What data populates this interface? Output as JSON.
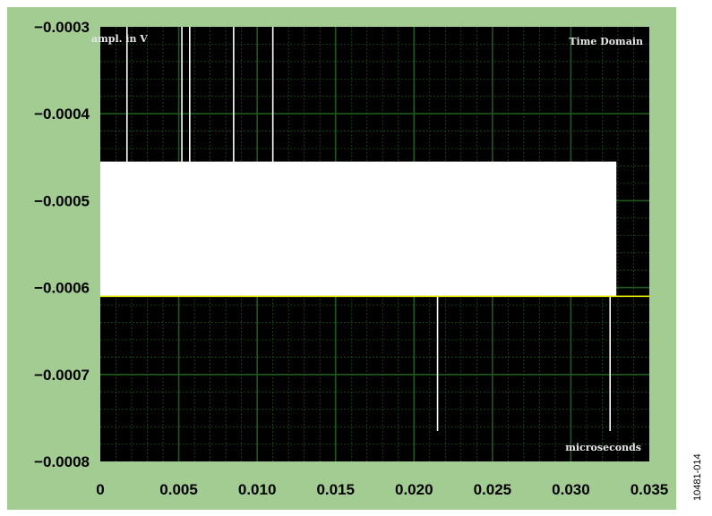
{
  "chart_data": {
    "type": "line",
    "title": "Time Domain",
    "xlabel": "microseconds",
    "ylabel": "ampl. in V",
    "xlim": [
      0,
      0.035
    ],
    "ylim": [
      -0.0008,
      -0.0003
    ],
    "x_ticks": [
      "0",
      "0.005",
      "0.010",
      "0.015",
      "0.020",
      "0.025",
      "0.030",
      "0.035"
    ],
    "x_tick_values": [
      0,
      0.005,
      0.01,
      0.015,
      0.02,
      0.025,
      0.03,
      0.035
    ],
    "y_ticks": [
      "−0.0003",
      "−0.0004",
      "−0.0005",
      "−0.0006",
      "−0.0007",
      "−0.0008"
    ],
    "y_tick_values": [
      -0.0003,
      -0.0004,
      -0.0005,
      -0.0006,
      -0.0007,
      -0.0008
    ],
    "grid": true,
    "series": [
      {
        "color": "#e8e800",
        "baseline": -0.00061,
        "band": {
          "x": [
            0,
            0.0329
          ],
          "y": [
            -0.00061,
            -0.000455
          ]
        },
        "spikes": [
          {
            "x": 0.0017,
            "y": -0.0003
          },
          {
            "x": 0.0052,
            "y": -0.0003
          },
          {
            "x": 0.0057,
            "y": -0.0003
          },
          {
            "x": 0.0085,
            "y": -0.0003
          },
          {
            "x": 0.011,
            "y": -0.0003
          },
          {
            "x": 0.0215,
            "y": -0.000765
          },
          {
            "x": 0.0325,
            "y": -0.000765
          }
        ]
      }
    ],
    "colors": {
      "frame": "#a3cc92",
      "plot_bg": "#000000",
      "grid": "#1e5a1e",
      "trace": "#ffffff",
      "baseline": "#e8e800"
    }
  },
  "figure_id": "10481-014"
}
